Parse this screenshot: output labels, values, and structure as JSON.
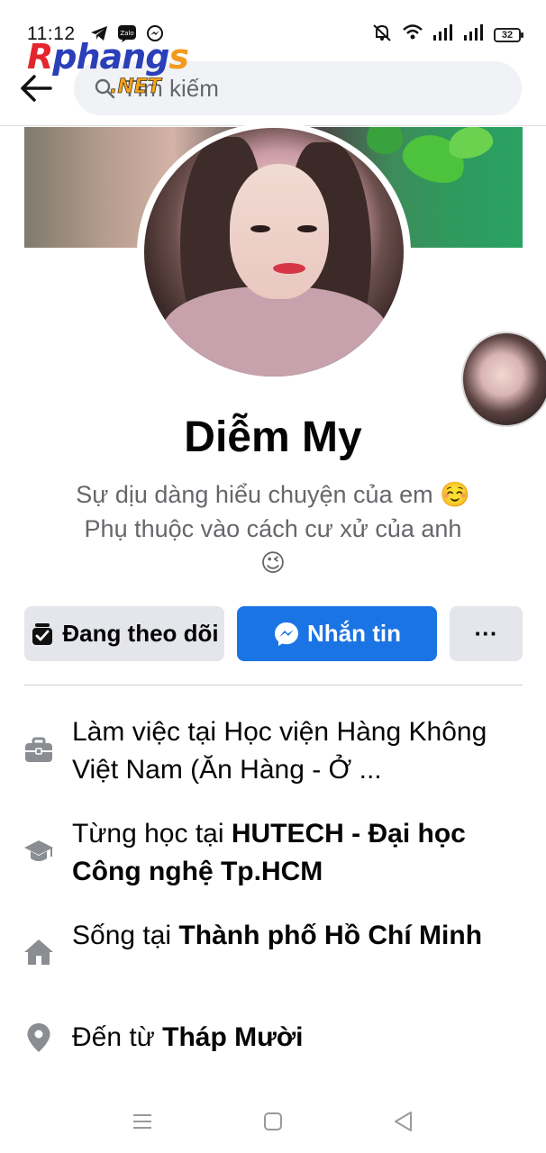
{
  "status_bar": {
    "time": "11:12",
    "left_icons": [
      "telegram-icon",
      "zalo-icon",
      "messenger-icon"
    ],
    "zalo_label": "Zalo",
    "right_icons": [
      "mute-bell-icon",
      "wifi-icon",
      "signal-icon",
      "signal-icon"
    ],
    "battery": "32"
  },
  "watermark": {
    "main": "Rphangs",
    "sub": ".NET"
  },
  "header": {
    "search_placeholder": "Tìm kiếm"
  },
  "profile": {
    "name": "Diễm My",
    "bio_line1": "Sự dịu dàng hiểu chuyện của em",
    "bio_emoji1": "☺️",
    "bio_line2": "Phụ thuộc vào cách cư xử của anh",
    "bio_emoji2": "😉"
  },
  "actions": {
    "following_label": "Đang theo dõi",
    "message_label": "Nhắn tin",
    "more_label": "···"
  },
  "info": {
    "work_prefix": "Làm việc tại Học viện Hàng Không Việt Nam (Ăn Hàng - Ở ...",
    "study_prefix": "Từng học tại ",
    "study_value": "HUTECH - Đại học Công nghệ Tp.HCM",
    "live_prefix": "Sống tại ",
    "live_value": "Thành phố Hồ Chí Minh",
    "from_prefix": "Đến từ ",
    "from_value": "Tháp Mười"
  },
  "colors": {
    "accent": "#1b74e4",
    "secondary_button": "#e4e6eb",
    "muted_text": "#65676b"
  }
}
